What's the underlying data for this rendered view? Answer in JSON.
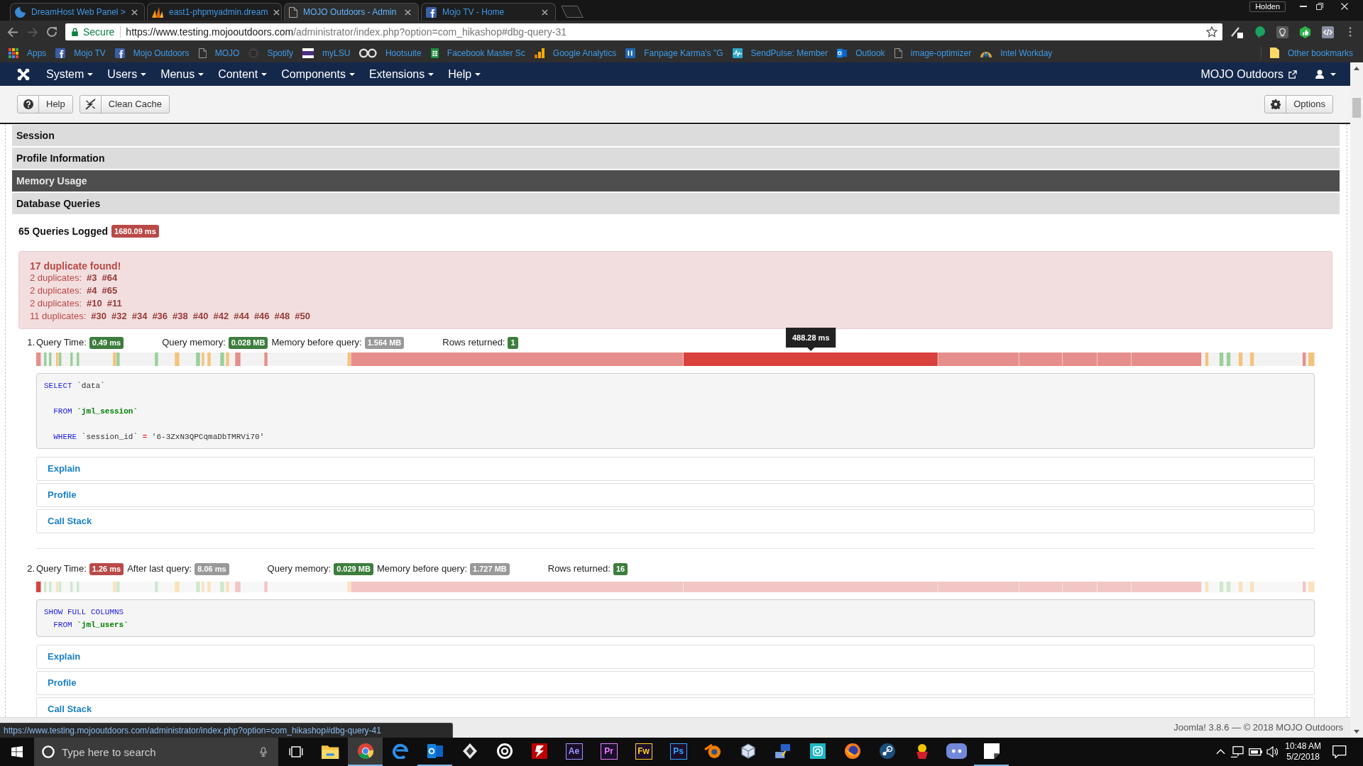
{
  "browser": {
    "tabs": [
      {
        "title": "DreamHost Web Panel >",
        "kind": "crescent",
        "selected": false
      },
      {
        "title": "east1-phpmyadmin.dream",
        "kind": "sails",
        "selected": false
      },
      {
        "title": "MOJO Outdoors - Admin",
        "kind": "page",
        "selected": true
      },
      {
        "title": "Mojo TV - Home",
        "kind": "social",
        "selected": false
      }
    ],
    "profile": "Holden",
    "address": {
      "security": "Secure",
      "host": "https://www.testing.mojooutdoors.com",
      "path": "/administrator/index.php?option=com_hikashop#dbg-query-31"
    },
    "bookmarks": [
      {
        "label": "Apps",
        "kind": "grid"
      },
      {
        "label": "Mojo TV",
        "kind": "social"
      },
      {
        "label": "Mojo Outdoors",
        "kind": "social"
      },
      {
        "label": "MOJO",
        "kind": "page"
      },
      {
        "label": "Spotify",
        "kind": "disc"
      },
      {
        "label": "myLSU",
        "kind": "emblem"
      },
      {
        "label": "Hootsuite",
        "kind": "owl"
      },
      {
        "label": "Facebook Master Sc",
        "kind": "sheet"
      },
      {
        "label": "Google Analytics",
        "kind": "bars"
      },
      {
        "label": "Fanpage Karma's \"G",
        "kind": "tile"
      },
      {
        "label": "SendPulse: Member",
        "kind": "pulse"
      },
      {
        "label": "Outlook",
        "kind": "mail"
      },
      {
        "label": "image-optimizer",
        "kind": "page"
      },
      {
        "label": "Intel Workday",
        "kind": "arc"
      }
    ],
    "other_bookmarks": "Other bookmarks"
  },
  "admin_menu": {
    "items": [
      {
        "label": "System"
      },
      {
        "label": "Users"
      },
      {
        "label": "Menus"
      },
      {
        "label": "Content"
      },
      {
        "label": "Components"
      },
      {
        "label": "Extensions"
      },
      {
        "label": "Help"
      }
    ],
    "site_link": "MOJO Outdoors"
  },
  "toolbar": {
    "buttons": [
      {
        "label": "Help",
        "kind": "help"
      },
      {
        "label": "Clean Cache",
        "kind": "cache"
      }
    ],
    "options_button": "Options"
  },
  "sections": [
    {
      "title": "Session",
      "hovered": false
    },
    {
      "title": "Profile Information",
      "hovered": false
    },
    {
      "title": "Memory Usage",
      "hovered": true
    },
    {
      "title": "Database Queries",
      "hovered": false
    }
  ],
  "queries_summary": {
    "title": "65 Queries Logged",
    "total": "1680.09 ms"
  },
  "duplicates": {
    "title": "17 duplicate found!",
    "groups": [
      {
        "label": "2 duplicates:",
        "refs": [
          "#3",
          "#64"
        ]
      },
      {
        "label": "2 duplicates:",
        "refs": [
          "#4",
          "#65"
        ]
      },
      {
        "label": "2 duplicates:",
        "refs": [
          "#10",
          "#11"
        ]
      },
      {
        "label": "11 duplicates:",
        "refs": [
          "#30",
          "#32",
          "#34",
          "#36",
          "#38",
          "#40",
          "#42",
          "#44",
          "#46",
          "#48",
          "#50"
        ]
      }
    ]
  },
  "queries": [
    {
      "number": "1.",
      "stat_groups": [
        {
          "items": [
            {
              "label": "Query Time:",
              "value": "0.49 ms",
              "color": "#3d7d3d"
            }
          ]
        },
        {
          "items": [
            {
              "label": "Query memory:",
              "value": "0.028 MB",
              "color": "#3d7d3d"
            },
            {
              "label": "Memory before query:",
              "value": "1.564 MB",
              "color": "#999999"
            }
          ]
        },
        {
          "items": [
            {
              "label": "Rows returned:",
              "value": "1",
              "color": "#3d7d3d"
            }
          ]
        }
      ],
      "timeline": {
        "hovered": true,
        "tooltip": "488.28 ms"
      },
      "sql": [
        {
          "kind": "keyword",
          "text": "SELECT"
        },
        {
          "kind": "plain",
          "text": " `data`\n\n  "
        },
        {
          "kind": "keyword",
          "text": "FROM"
        },
        {
          "kind": "table",
          "text": " `jml_session`\n\n  "
        },
        {
          "kind": "keyword",
          "text": "WHERE"
        },
        {
          "kind": "plain",
          "text": " `session_id` "
        },
        {
          "kind": "operator",
          "text": "="
        },
        {
          "kind": "plain",
          "text": " '6-3ZxN3QPCqmaDbTMRVi70'"
        }
      ],
      "panels": [
        "Explain",
        "Profile",
        "Call Stack"
      ]
    },
    {
      "number": "2.",
      "stat_groups": [
        {
          "items": [
            {
              "label": "Query Time:",
              "value": "1.26 ms",
              "color": "#b94a48"
            },
            {
              "label": "After last query:",
              "value": "8.06 ms",
              "color": "#999999"
            }
          ]
        },
        {
          "items": [
            {
              "label": "Query memory:",
              "value": "0.029 MB",
              "color": "#3d7d3d"
            },
            {
              "label": "Memory before query:",
              "value": "1.727 MB",
              "color": "#999999"
            }
          ]
        },
        {
          "items": [
            {
              "label": "Rows returned:",
              "value": "16",
              "color": "#3d7d3d"
            }
          ]
        }
      ],
      "timeline": {
        "hovered": false
      },
      "sql": [
        {
          "kind": "keyword",
          "text": "SHOW FULL COLUMNS\n  FROM"
        },
        {
          "kind": "table",
          "text": " `jml_users`"
        }
      ],
      "panels": [
        "Explain",
        "Profile",
        "Call Stack"
      ]
    }
  ],
  "footer": "Joomla! 3.8.6 — © 2018 MOJO Outdoors",
  "status_url": "https://www.testing.mojooutdoors.com/administrator/index.php?option=com_hikashop#dbg-query-41",
  "taskbar": {
    "search_placeholder": "Type here to search",
    "apps": [
      {
        "kind": "folder",
        "running": false,
        "focused": false
      },
      {
        "kind": "segments",
        "running": true,
        "focused": true
      },
      {
        "kind": "swirl",
        "running": false,
        "focused": false
      },
      {
        "kind": "mail",
        "running": true,
        "focused": false
      },
      {
        "kind": "diamond",
        "running": false,
        "focused": false
      },
      {
        "kind": "target",
        "running": false,
        "focused": false
      },
      {
        "kind": "bolt",
        "running": false,
        "focused": false
      },
      {
        "kind": "tile",
        "label": "Ae",
        "color": "#9999ff",
        "running": false,
        "focused": false
      },
      {
        "kind": "tile",
        "label": "Pr",
        "color": "#e77cff",
        "running": false,
        "focused": false
      },
      {
        "kind": "tile",
        "label": "Fw",
        "color": "#ffd21f",
        "running": false,
        "focused": false
      },
      {
        "kind": "tile",
        "label": "Ps",
        "color": "#31a8ff",
        "running": false,
        "focused": false
      },
      {
        "kind": "orbit",
        "running": false,
        "focused": false
      },
      {
        "kind": "cube",
        "running": false,
        "focused": false
      },
      {
        "kind": "network",
        "running": false,
        "focused": false
      },
      {
        "kind": "lens",
        "running": false,
        "focused": false
      },
      {
        "kind": "globe",
        "running": false,
        "focused": false
      },
      {
        "kind": "round",
        "running": false,
        "focused": false
      },
      {
        "kind": "character",
        "running": false,
        "focused": false
      },
      {
        "kind": "face",
        "running": false,
        "focused": false
      },
      {
        "kind": "note",
        "running": true,
        "focused": false
      }
    ],
    "time": "10:48 AM",
    "date": "5/2/2018"
  }
}
